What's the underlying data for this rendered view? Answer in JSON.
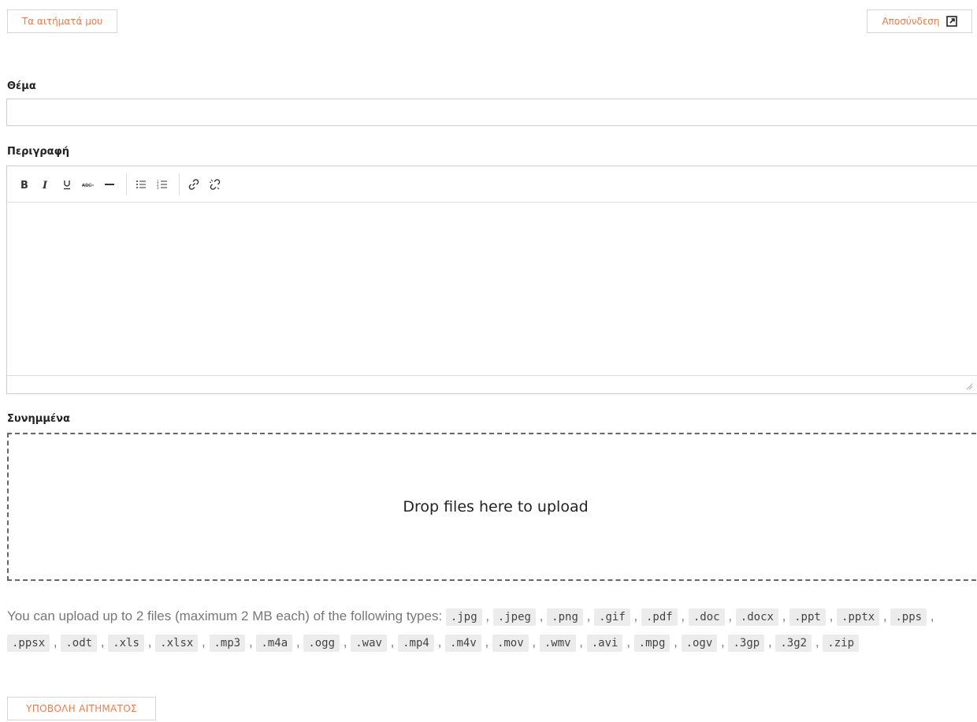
{
  "header": {
    "my_tickets_label": "Τα αιτήματά μου",
    "logout_label": "Αποσύνδεση"
  },
  "form": {
    "subject_label": "Θέμα",
    "subject_value": "",
    "description_label": "Περιγραφή",
    "attachments_label": "Συνημμένα",
    "dropzone_text": "Drop files here to upload",
    "upload_info_text": "You can upload up to 2 files (maximum 2 MB each) of the following types:",
    "file_types": [
      ".jpg",
      ".jpeg",
      ".png",
      ".gif",
      ".pdf",
      ".doc",
      ".docx",
      ".ppt",
      ".pptx",
      ".pps",
      ".ppsx",
      ".odt",
      ".xls",
      ".xlsx",
      ".mp3",
      ".m4a",
      ".ogg",
      ".wav",
      ".mp4",
      ".m4v",
      ".mov",
      ".wmv",
      ".avi",
      ".mpg",
      ".ogv",
      ".3gp",
      ".3g2",
      ".zip"
    ],
    "submit_label": "ΥΠΟΒΟΛΗ ΑΙΤΗΜΑΤΟΣ"
  },
  "editor_toolbar": [
    {
      "name": "bold-icon",
      "glyph": "B"
    },
    {
      "name": "italic-icon",
      "glyph": "I"
    },
    {
      "name": "underline-icon",
      "glyph": "U"
    },
    {
      "name": "strikethrough-icon",
      "glyph": "ABC"
    },
    {
      "name": "horizontal-rule-icon",
      "glyph": "—"
    },
    {
      "name": "bullet-list-icon",
      "glyph": "•≡"
    },
    {
      "name": "numbered-list-icon",
      "glyph": "1≡"
    },
    {
      "name": "link-icon",
      "glyph": "🔗"
    },
    {
      "name": "unlink-icon",
      "glyph": "⛓"
    }
  ],
  "colors": {
    "accent": "#ee7b50",
    "border": "#cccccc",
    "tag_bg": "#ececec"
  }
}
